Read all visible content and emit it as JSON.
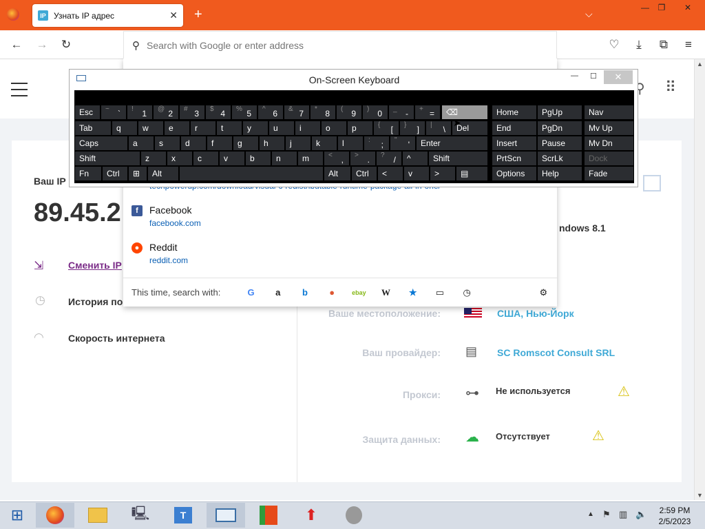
{
  "browser": {
    "tab_title": "Узнать IP адрес",
    "tab_badge": "IP",
    "new_tab": "+",
    "url_placeholder": "Search with Google or enter address",
    "accent": "#f05a1e"
  },
  "site": {
    "ip_label": "Ваш IP",
    "ip_value": "89.45.2",
    "menu": [
      "Сменить IP",
      "История по",
      "Скорость интернета"
    ],
    "os_partial": "ndows 8.1",
    "rows": [
      {
        "label": "Ваше местоположение:",
        "value": "США, Нью-Йорк"
      },
      {
        "label": "Ваш провайдер:",
        "value": "SC Romscot Consult SRL"
      },
      {
        "label": "Прокси:",
        "value": "Не используется"
      },
      {
        "label": "Защита данных:",
        "value": "Отсутствует"
      }
    ]
  },
  "dropdown": {
    "partial_url": "techpowerup.com/download/visual-c-redistributable-runtime-package-all-in-one/",
    "suggestions": [
      {
        "title": "Facebook",
        "url": "facebook.com",
        "icon": "facebook-icon",
        "color": "#3b5998"
      },
      {
        "title": "Reddit",
        "url": "reddit.com",
        "icon": "reddit-icon",
        "color": "#ff4500"
      }
    ],
    "search_with": "This time, search with:",
    "engines": [
      "google-icon",
      "amazon-icon",
      "bing-icon",
      "duckduckgo-icon",
      "ebay-icon",
      "wikipedia-icon",
      "bookmarks-icon",
      "tabs-icon",
      "history-icon"
    ]
  },
  "osk": {
    "title": "On-Screen Keyboard",
    "keys": {
      "r1": [
        "Esc",
        "~ `",
        "! 1",
        "@ 2",
        "# 3",
        "$ 4",
        "% 5",
        "^ 6",
        "& 7",
        "* 8",
        "( 9",
        ") 0",
        "_ -",
        "+ ="
      ],
      "r2": [
        "Tab",
        "q",
        "w",
        "e",
        "r",
        "t",
        "y",
        "u",
        "i",
        "o",
        "p",
        "{ [",
        "} ]",
        "| \\",
        "Del"
      ],
      "r3": [
        "Caps",
        "a",
        "s",
        "d",
        "f",
        "g",
        "h",
        "j",
        "k",
        "l",
        ": ;",
        "\" '",
        "Enter"
      ],
      "r4": [
        "Shift",
        "z",
        "x",
        "c",
        "v",
        "b",
        "n",
        "m",
        "< ,",
        "> .",
        "? /",
        "^",
        "Shift"
      ],
      "r5": [
        "Fn",
        "Ctrl",
        "Alt",
        "Alt",
        "Ctrl",
        "<",
        "v",
        ">"
      ],
      "nav": [
        "Home",
        "PgUp",
        "Nav",
        "End",
        "PgDn",
        "Mv Up",
        "Insert",
        "Pause",
        "Mv Dn",
        "PrtScn",
        "ScrLk",
        "Dock",
        "Options",
        "Help",
        "Fade"
      ]
    }
  },
  "taskbar": {
    "time": "2:59 PM",
    "date": "2/5/2023"
  }
}
